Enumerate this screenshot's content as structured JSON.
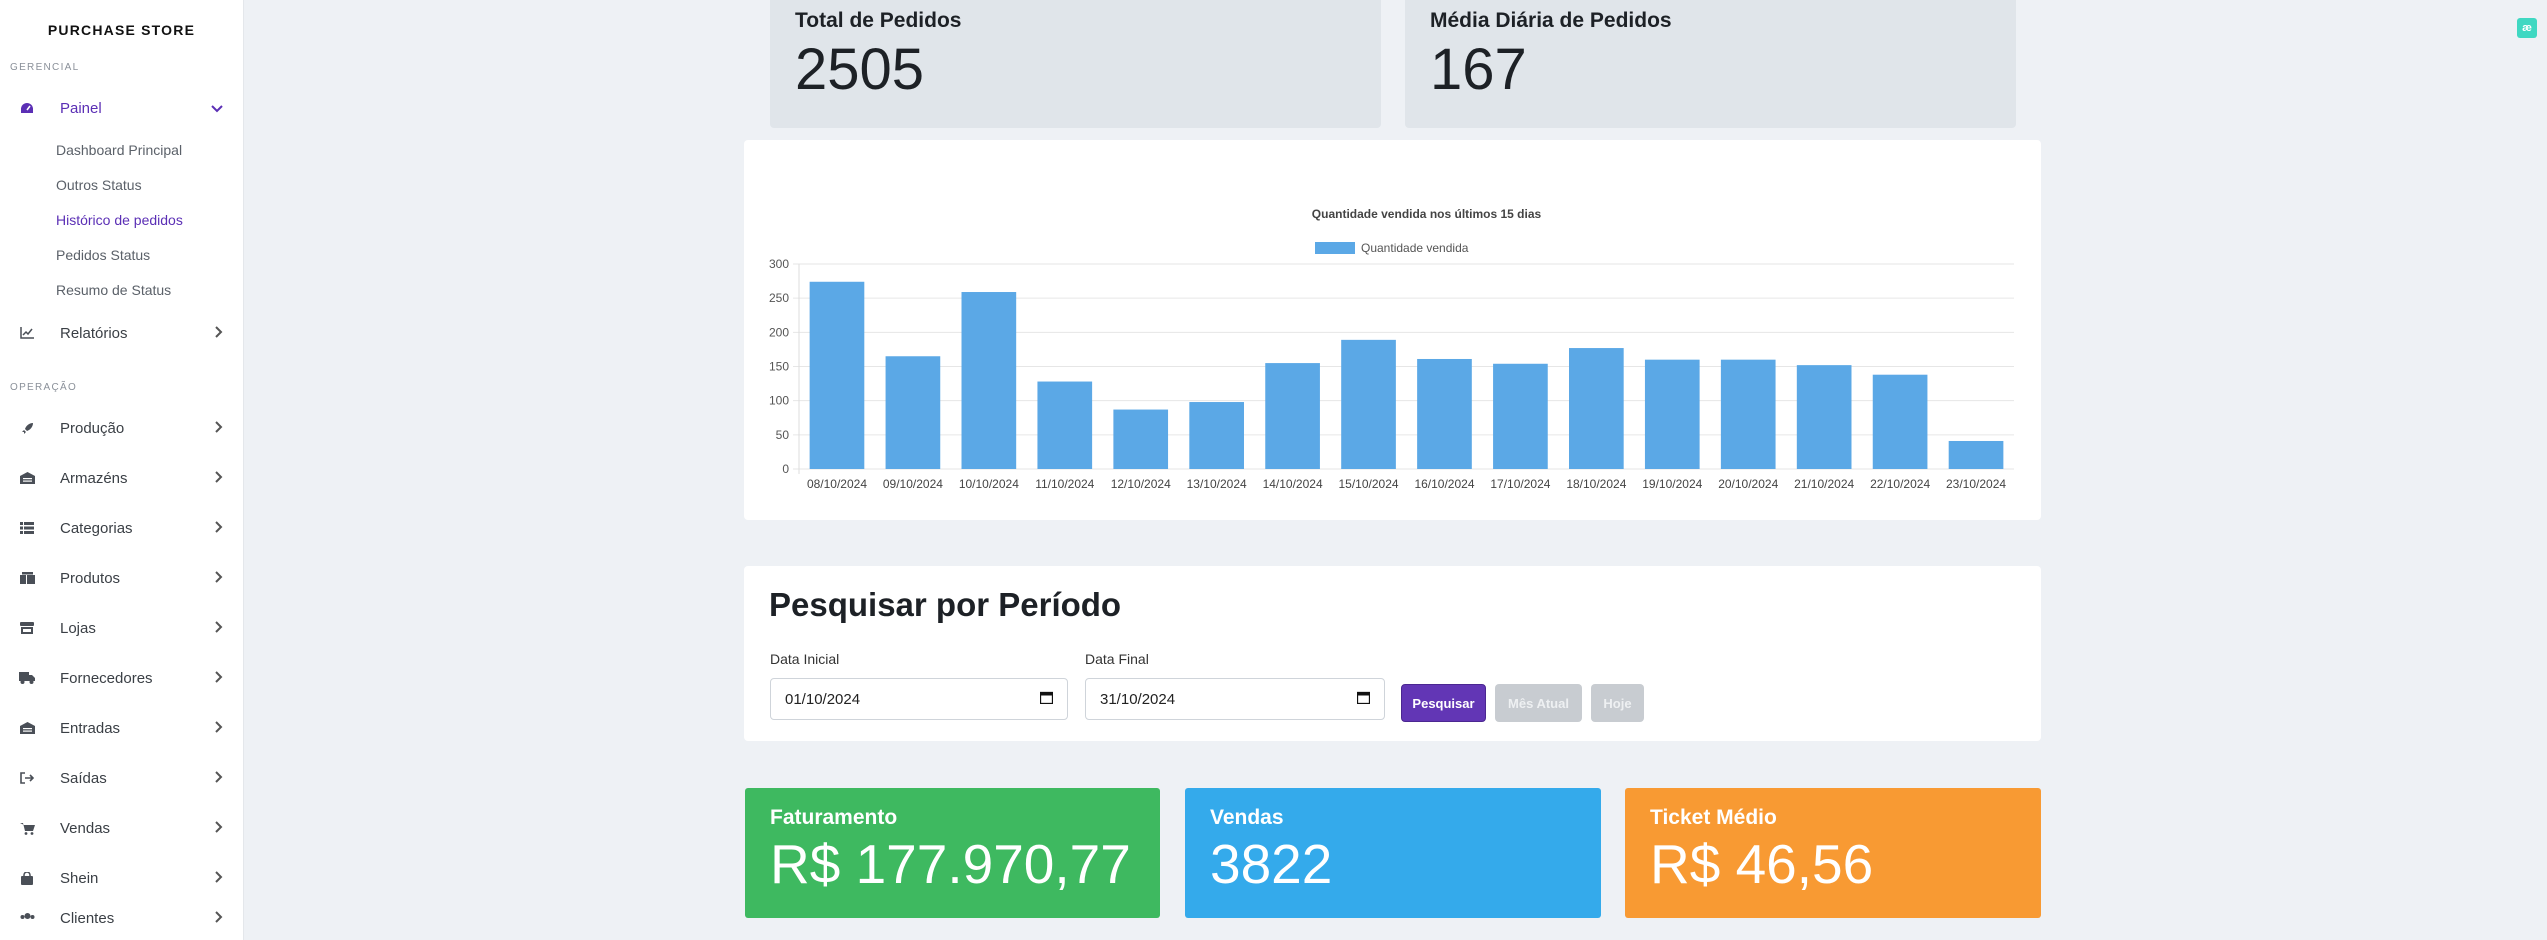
{
  "sidebar": {
    "brand": "PURCHASE STORE",
    "sections": {
      "gerencial": "GERENCIAL",
      "operacao": "OPERAÇÃO"
    },
    "painel": {
      "label": "Painel",
      "sub": [
        "Dashboard Principal",
        "Outros Status",
        "Histórico de pedidos",
        "Pedidos Status",
        "Resumo de Status"
      ]
    },
    "relatorios": "Relatórios",
    "items": [
      "Produção",
      "Armazéns",
      "Categorias",
      "Produtos",
      "Lojas",
      "Fornecedores",
      "Entradas",
      "Saídas",
      "Vendas",
      "Shein",
      "Clientes"
    ]
  },
  "top_stats": {
    "total_label": "Total de Pedidos",
    "total_value": "2505",
    "media_label": "Média Diária de Pedidos",
    "media_value": "167"
  },
  "chart_data": {
    "type": "bar",
    "title": "Quantidade vendida nos últimos 15 dias",
    "legend": "top",
    "categories": [
      "08/10/2024",
      "09/10/2024",
      "10/10/2024",
      "11/10/2024",
      "12/10/2024",
      "13/10/2024",
      "14/10/2024",
      "15/10/2024",
      "16/10/2024",
      "17/10/2024",
      "18/10/2024",
      "19/10/2024",
      "20/10/2024",
      "21/10/2024",
      "22/10/2024",
      "23/10/2024"
    ],
    "series": [
      {
        "name": "Quantidade vendida",
        "values": [
          274,
          165,
          259,
          128,
          87,
          98,
          155,
          189,
          161,
          154,
          177,
          160,
          160,
          152,
          138,
          41
        ],
        "color": "#5ba8e6"
      }
    ],
    "yticks": [
      "0",
      "50",
      "100",
      "150",
      "200",
      "250",
      "300"
    ],
    "ylim": [
      0,
      300
    ],
    "grid": true
  },
  "search": {
    "title": "Pesquisar por Período",
    "start_label": "Data Inicial",
    "start_value": "01/10/2024",
    "end_label": "Data Final",
    "end_value": "31/10/2024",
    "btn_search": "Pesquisar",
    "btn_month": "Mês Atual",
    "btn_today": "Hoje"
  },
  "kpis": {
    "faturamento_label": "Faturamento",
    "faturamento_value": "R$ 177.970,77",
    "faturamento_color": "#3eb960",
    "vendas_label": "Vendas",
    "vendas_value": "3822",
    "vendas_color": "#34aaeb",
    "ticket_label": "Ticket Médio",
    "ticket_value": "R$ 46,56",
    "ticket_color": "#f89a33"
  },
  "corner_icon": "æ"
}
